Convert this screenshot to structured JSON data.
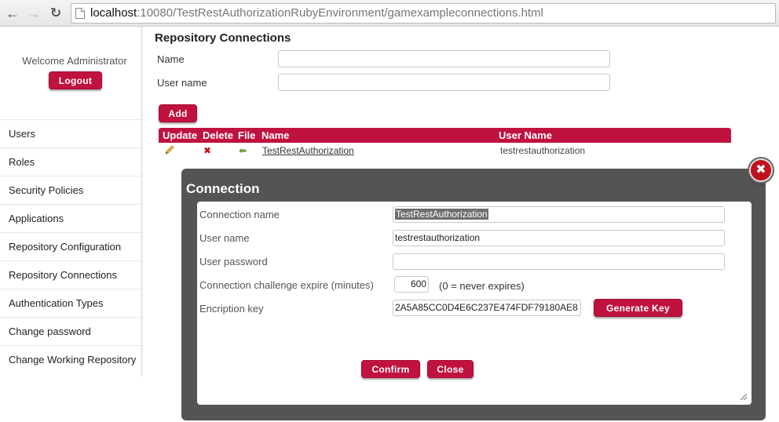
{
  "browser": {
    "url_host": "localhost",
    "url_path": ":10080/TestRestAuthorizationRubyEnvironment/gamexampleconnections.html"
  },
  "sidebar": {
    "welcome": "Welcome Administrator",
    "logout_label": "Logout",
    "items": [
      {
        "label": "Users"
      },
      {
        "label": "Roles"
      },
      {
        "label": "Security Policies"
      },
      {
        "label": "Applications"
      },
      {
        "label": "Repository Configuration"
      },
      {
        "label": "Repository Connections"
      },
      {
        "label": "Authentication Types"
      },
      {
        "label": "Change password"
      },
      {
        "label": "Change Working Repository"
      }
    ]
  },
  "main": {
    "title": "Repository Connections",
    "name_label": "Name",
    "name_value": "",
    "username_label": "User name",
    "username_value": "",
    "add_label": "Add",
    "table": {
      "headers": {
        "update": "Update",
        "delete": "Delete",
        "file": "File",
        "name": "Name",
        "user_name": "User Name"
      },
      "rows": [
        {
          "name": "TestRestAuthorization",
          "user_name": "testrestauthorization"
        }
      ]
    }
  },
  "modal": {
    "title": "Connection",
    "close_icon": "close-icon",
    "connection_name_label": "Connection name",
    "connection_name_value": "TestRestAuthorization",
    "user_name_label": "User name",
    "user_name_value": "testrestauthorization",
    "user_password_label": "User password",
    "user_password_value": "",
    "expire_label": "Connection challenge expire (minutes)",
    "expire_value": "600",
    "expire_hint": "(0 = never expires)",
    "key_label": "Encription key",
    "key_value": "2A5A85CC0D4E6C237E474FDF79180AE8",
    "generate_label": "Generate Key",
    "confirm_label": "Confirm",
    "close_label": "Close"
  },
  "colors": {
    "accent": "#c0123f",
    "modal_bg": "#545454"
  }
}
